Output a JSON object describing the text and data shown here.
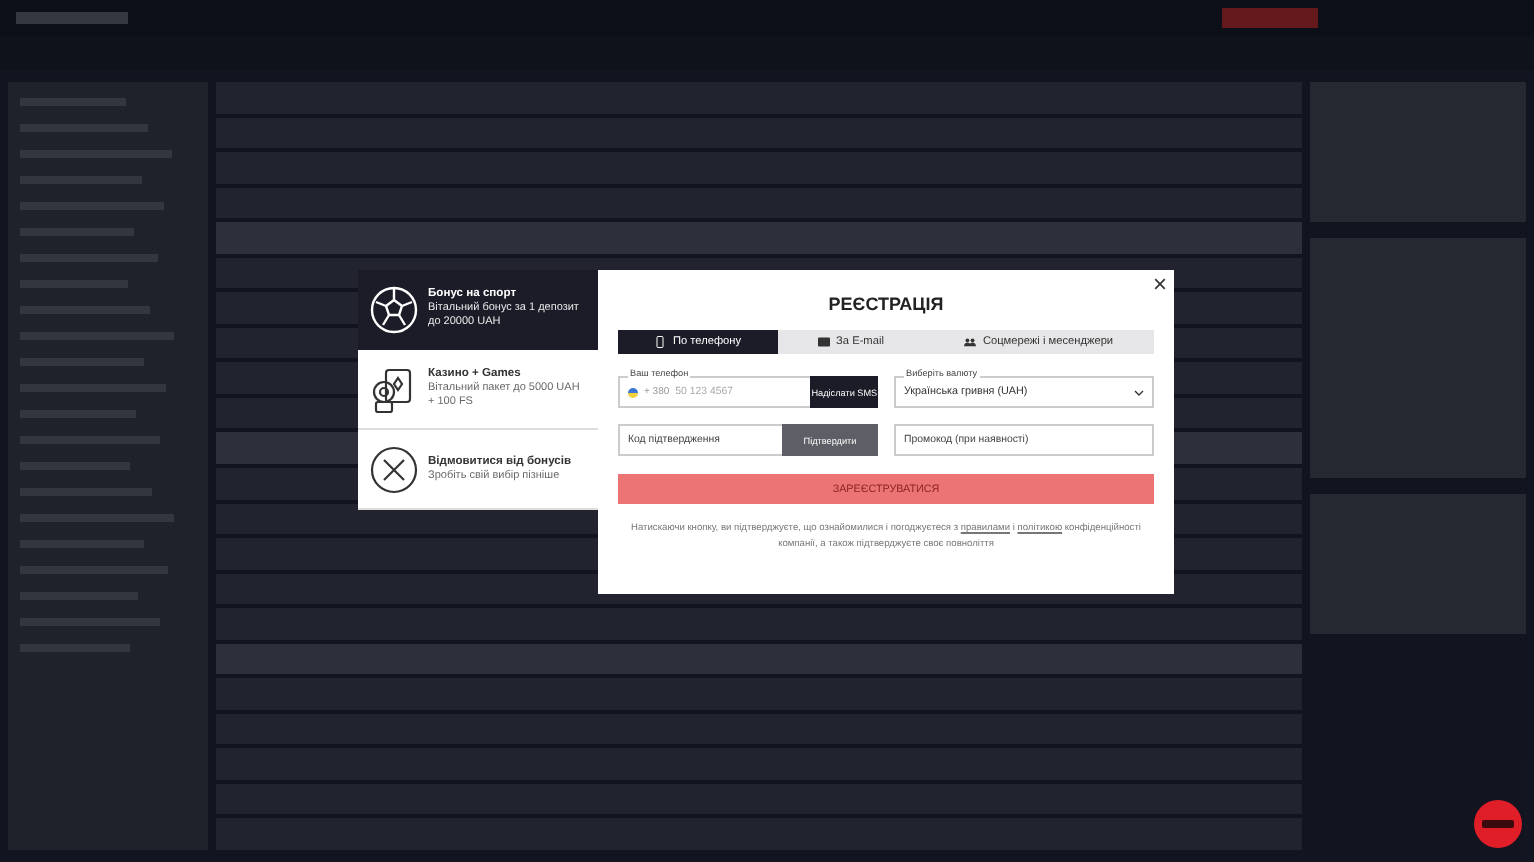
{
  "bonus_options": [
    {
      "kind": "sport",
      "title": "Бонус на спорт",
      "description": "Вітальний бонус за 1 депозит до 20000 UAH",
      "selected": true
    },
    {
      "kind": "casino",
      "title": "Казино + Games",
      "description": "Вітальний пакет до 5000 UAH + 100 FS",
      "selected": false
    },
    {
      "kind": "decline",
      "title": "Відмовитися від бонусів",
      "description": "Зробіть свій вибір пізніше",
      "selected": false
    }
  ],
  "dialog": {
    "title": "РЕЄСТРАЦІЯ",
    "tabs": [
      {
        "kind": "phone",
        "label": "По телефону",
        "selected": true
      },
      {
        "kind": "email",
        "label": "За E-mail",
        "selected": false
      },
      {
        "kind": "social",
        "label": "Соцмережі і месенджери",
        "selected": false
      }
    ],
    "phone": {
      "label": "Ваш телефон",
      "code": "+ 380",
      "placeholder": "50 123 4567",
      "button": "Надіслати SMS"
    },
    "currency": {
      "label": "Виберіть валюту",
      "value": "Українська гривня (UAH)"
    },
    "confirm": {
      "placeholder": "Код підтвердження",
      "button": "Підтвердити"
    },
    "promo": {
      "placeholder": "Промокод (при наявності)"
    },
    "submit": "ЗАРЕЄСТРУВАТИСЯ",
    "legal": {
      "before": "Натискаючи кнопку, ви підтверджуєте, що ознайомилися і погоджуєтеся з",
      "rules_link": "правилами",
      "middle": "і",
      "policy_link": "політикою",
      "after": "конфіденційності компанії, а також підтверджуєте своє повноліття"
    }
  }
}
